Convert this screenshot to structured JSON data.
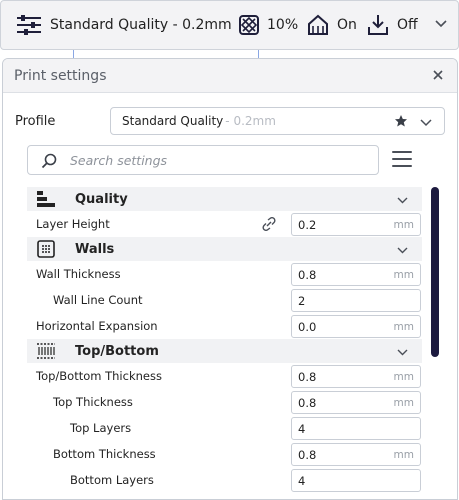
{
  "header": {
    "profile_label": "Standard Quality - 0.2mm",
    "infill_value": "10%",
    "support_value": "On",
    "adhesion_value": "Off"
  },
  "panel": {
    "title": "Print settings",
    "profile_label": "Profile",
    "profile_name": "Standard Quality",
    "profile_suffix": "- 0.2mm",
    "search_placeholder": "Search settings"
  },
  "sections": {
    "quality": {
      "label": "Quality",
      "layer_height": {
        "label": "Layer Height",
        "value": "0.2",
        "unit": "mm"
      }
    },
    "walls": {
      "label": "Walls",
      "wall_thickness": {
        "label": "Wall Thickness",
        "value": "0.8",
        "unit": "mm"
      },
      "wall_line_count": {
        "label": "Wall Line Count",
        "value": "2"
      },
      "horizontal_expansion": {
        "label": "Horizontal Expansion",
        "value": "0.0",
        "unit": "mm"
      }
    },
    "topbottom": {
      "label": "Top/Bottom",
      "tb_thickness": {
        "label": "Top/Bottom Thickness",
        "value": "0.8",
        "unit": "mm"
      },
      "top_thickness": {
        "label": "Top Thickness",
        "value": "0.8",
        "unit": "mm"
      },
      "top_layers": {
        "label": "Top Layers",
        "value": "4"
      },
      "bottom_thickness": {
        "label": "Bottom Thickness",
        "value": "0.8",
        "unit": "mm"
      },
      "bottom_layers": {
        "label": "Bottom Layers",
        "value": "4"
      }
    }
  },
  "colors": {
    "accent": "#3c6cd2",
    "scrollbar": "#1c1a3f",
    "category_bg": "#f1f2f4"
  },
  "icons": [
    "sliders-icon",
    "infill-icon",
    "support-icon",
    "adhesion-icon",
    "chevron-down-icon",
    "close-icon",
    "star-icon",
    "search-icon",
    "menu-icon",
    "link-icon",
    "quality-icon",
    "walls-icon",
    "topbottom-icon"
  ]
}
